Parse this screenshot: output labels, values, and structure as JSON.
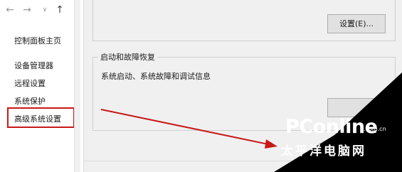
{
  "nav": {
    "back_icon": "back-arrow-icon",
    "forward_icon": "forward-arrow-icon",
    "dropdown_icon": "chevron-down-icon",
    "up_icon": "up-arrow-icon",
    "home_label": "控制面板主页",
    "items": [
      {
        "label": "设备管理器"
      },
      {
        "label": "远程设置"
      },
      {
        "label": "系统保护"
      },
      {
        "label": "高级系统设置"
      }
    ]
  },
  "dialog": {
    "top_button_label": "设置(E)...",
    "startup_group": {
      "title": "启动和故障恢复",
      "description": "系统启动、系统故障和调试信息"
    }
  },
  "watermark": {
    "brand": "PConline",
    "domain": ".com.cn",
    "chinese": "太平洋电脑网"
  },
  "colors": {
    "highlight_box": "#c8191a",
    "arrow": "#c8191a",
    "corner": "#000000"
  }
}
